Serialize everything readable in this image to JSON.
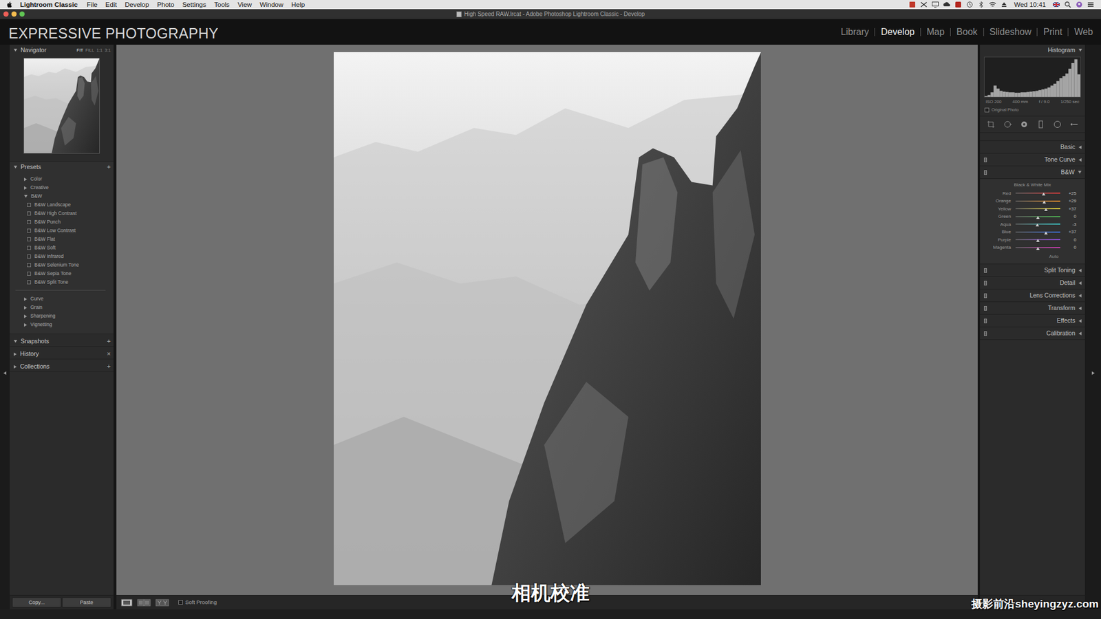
{
  "menubar": {
    "app": "Lightroom Classic",
    "items": [
      "File",
      "Edit",
      "Develop",
      "Photo",
      "Settings",
      "Tools",
      "View",
      "Window",
      "Help"
    ],
    "clock": "Wed 10:41"
  },
  "window": {
    "title": "High Speed RAW.lrcat - Adobe Photoshop Lightroom Classic - Develop"
  },
  "identity_plate": "EXPRESSIVE PHOTOGRAPHY",
  "modules": [
    {
      "label": "Library",
      "selected": false
    },
    {
      "label": "Develop",
      "selected": true
    },
    {
      "label": "Map",
      "selected": false
    },
    {
      "label": "Book",
      "selected": false
    },
    {
      "label": "Slideshow",
      "selected": false
    },
    {
      "label": "Print",
      "selected": false
    },
    {
      "label": "Web",
      "selected": false
    }
  ],
  "navigator": {
    "title": "Navigator",
    "expanded": true,
    "zoom": [
      {
        "label": "FIT",
        "selected": true
      },
      {
        "label": "FILL",
        "selected": false
      },
      {
        "label": "1:1",
        "selected": false
      },
      {
        "label": "3:1",
        "selected": false
      }
    ]
  },
  "presets": {
    "title": "Presets",
    "expanded": true,
    "action": "+",
    "groups": [
      {
        "label": "Color",
        "expanded": false,
        "items": []
      },
      {
        "label": "Creative",
        "expanded": false,
        "items": []
      },
      {
        "label": "B&W",
        "expanded": true,
        "items": [
          "B&W Landscape",
          "B&W High Contrast",
          "B&W Punch",
          "B&W Low Contrast",
          "B&W Flat",
          "B&W Soft",
          "B&W Infrared",
          "B&W Selenium Tone",
          "B&W Sepia Tone",
          "B&W Split Tone"
        ]
      }
    ],
    "tool_groups": [
      {
        "label": "Curve",
        "expanded": false
      },
      {
        "label": "Grain",
        "expanded": false
      },
      {
        "label": "Sharpening",
        "expanded": false
      },
      {
        "label": "Vignetting",
        "expanded": false
      }
    ]
  },
  "left_sections": [
    {
      "title": "Snapshots",
      "expanded": true,
      "action": "+"
    },
    {
      "title": "History",
      "expanded": false,
      "action": "×"
    },
    {
      "title": "Collections",
      "expanded": false,
      "action": "+"
    }
  ],
  "left_buttons": [
    "Copy...",
    "Paste"
  ],
  "toolbar": {
    "soft_proofing": {
      "label": "Soft Proofing",
      "checked": false
    }
  },
  "histogram": {
    "title": "Histogram",
    "expanded": true,
    "values": [
      0.02,
      0.05,
      0.12,
      0.3,
      0.22,
      0.16,
      0.14,
      0.13,
      0.12,
      0.12,
      0.11,
      0.11,
      0.12,
      0.12,
      0.13,
      0.14,
      0.15,
      0.16,
      0.18,
      0.2,
      0.22,
      0.25,
      0.3,
      0.35,
      0.42,
      0.5,
      0.55,
      0.62,
      0.75,
      0.9,
      1.0,
      0.6
    ],
    "info": [
      "ISO 200",
      "400 mm",
      "f / 9.0",
      "1/250 sec"
    ],
    "original_photo": {
      "label": "Original Photo",
      "checked": false
    }
  },
  "right_panels_top": [
    {
      "title": "Basic",
      "expanded": false,
      "kind": "plain"
    },
    {
      "title": "Tone Curve",
      "expanded": false,
      "kind": "switch"
    }
  ],
  "bw": {
    "title": "B&W",
    "expanded": true,
    "subtitle": "Black & White Mix",
    "sliders": [
      {
        "label": "Red",
        "value": "+25",
        "level": 0.625,
        "color": "#d23b3b"
      },
      {
        "label": "Orange",
        "value": "+29",
        "level": 0.645,
        "color": "#e08a2a"
      },
      {
        "label": "Yellow",
        "value": "+37",
        "level": 0.685,
        "color": "#d8c83a"
      },
      {
        "label": "Green",
        "value": "0",
        "level": 0.5,
        "color": "#4caf50"
      },
      {
        "label": "Aqua",
        "value": "-3",
        "level": 0.485,
        "color": "#3bbfbf"
      },
      {
        "label": "Blue",
        "value": "+37",
        "level": 0.685,
        "color": "#3b6fd8"
      },
      {
        "label": "Purple",
        "value": "0",
        "level": 0.5,
        "color": "#8a4bd0"
      },
      {
        "label": "Magenta",
        "value": "0",
        "level": 0.5,
        "color": "#c93ab0"
      }
    ],
    "auto": "Auto"
  },
  "right_panels_bottom": [
    {
      "title": "Split Toning",
      "expanded": false,
      "kind": "switch"
    },
    {
      "title": "Detail",
      "expanded": false,
      "kind": "switch"
    },
    {
      "title": "Lens Corrections",
      "expanded": false,
      "kind": "switch"
    },
    {
      "title": "Transform",
      "expanded": false,
      "kind": "switch"
    },
    {
      "title": "Effects",
      "expanded": false,
      "kind": "switch"
    },
    {
      "title": "Calibration",
      "expanded": false,
      "kind": "switch"
    }
  ],
  "subtitle": "相机校准",
  "watermark": "摄影前沿sheyingzyz.com"
}
